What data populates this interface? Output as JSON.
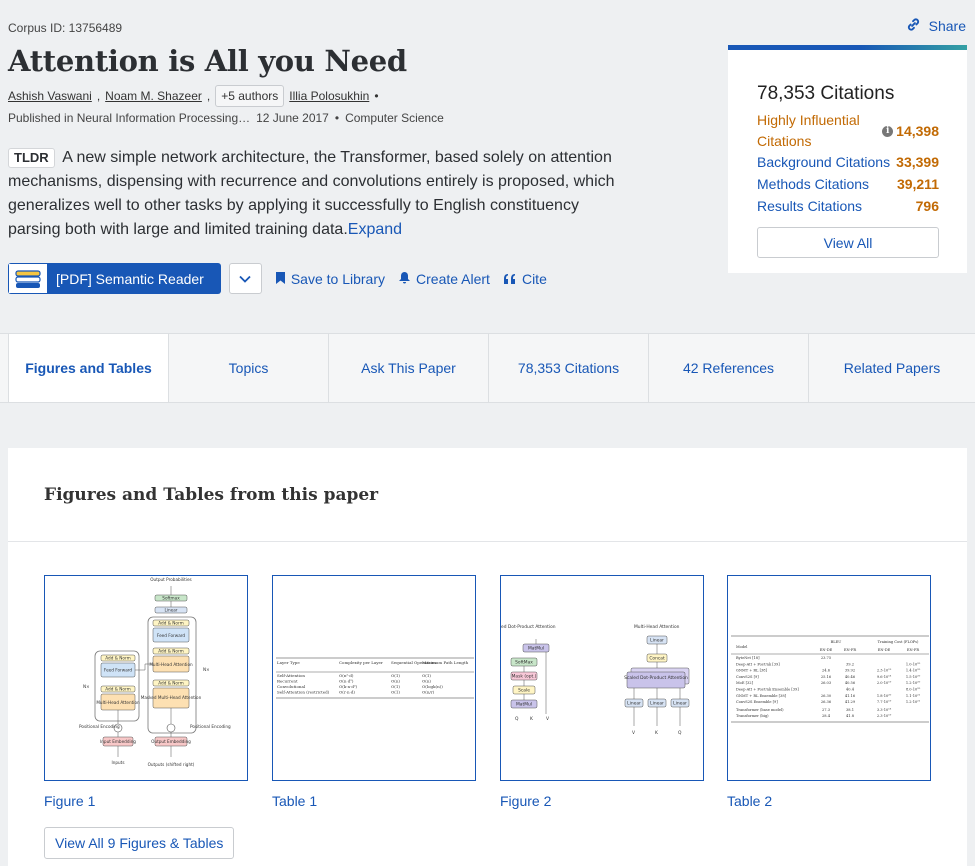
{
  "header": {
    "corpus_id": "Corpus ID: 13756489",
    "share": "Share",
    "title": "Attention is All you Need",
    "authors": [
      "Ashish Vaswani",
      "Noam M. Shazeer"
    ],
    "more_authors": "+5 authors",
    "last_author": "Illia Polosukhin",
    "venue": "Published in Neural Information Processing…",
    "date": "12 June 2017",
    "field": "Computer Science"
  },
  "tldr": {
    "tag": "TLDR",
    "text": "A new simple network architecture, the Transformer, based solely on attention mechanisms, dispensing with recurrence and convolutions entirely is proposed, which generalizes well to other tasks by applying it successfully to English constituency parsing both with large and limited training data.",
    "expand": "Expand"
  },
  "actions": {
    "reader": "[PDF] Semantic Reader",
    "save": "Save to Library",
    "alert": "Create Alert",
    "cite": "Cite"
  },
  "citations": {
    "total": "78,353 Citations",
    "highly_label_1": "Highly Influential",
    "highly_label_2": "Citations",
    "highly_value": "14,398",
    "background_label": "Background Citations",
    "background_value": "33,399",
    "methods_label": "Methods Citations",
    "methods_value": "39,211",
    "results_label": "Results Citations",
    "results_value": "796",
    "view_all": "View All"
  },
  "tabs": [
    {
      "label": "Figures and Tables"
    },
    {
      "label": "Topics"
    },
    {
      "label": "Ask This Paper"
    },
    {
      "label": "78,353 Citations"
    },
    {
      "label": "42 References"
    },
    {
      "label": "Related Papers"
    }
  ],
  "figures": {
    "title": "Figures and Tables from this paper",
    "items": [
      {
        "caption": "Figure 1"
      },
      {
        "caption": "Table 1"
      },
      {
        "caption": "Figure 2"
      },
      {
        "caption": "Table 2"
      }
    ],
    "view_all": "View All 9 Figures & Tables"
  },
  "fig1_labels": {
    "output_probs": "Output Probabilities",
    "softmax": "Softmax",
    "linear": "Linear",
    "add_norm": "Add & Norm",
    "ffn": "Feed Forward",
    "mha": "Multi-Head Attention",
    "masked": "Masked Multi-Head Attention",
    "nx": "N×",
    "pos_enc": "Positional Encoding",
    "in_emb": "Input Embedding",
    "out_emb": "Output Embedding",
    "inputs": "Inputs",
    "outputs": "Outputs (shifted right)"
  },
  "fig2_labels": {
    "sdpa": "ed Dot-Product Attention",
    "mha": "Multi-Head Attention",
    "matmul": "MatMul",
    "softmax": "SoftMax",
    "mask": "Mask (opt.)",
    "scale": "Scale",
    "linear": "Linear",
    "concat": "Concat",
    "sdpa_box": "Scaled Dot-Product Attention",
    "q": "Q",
    "k": "K",
    "v": "V"
  },
  "table1": {
    "headers": [
      "Layer Type",
      "Complexity per Layer",
      "Sequential Operations",
      "Maximum Path Length"
    ],
    "rows": [
      [
        "Self-Attention",
        "O(n²·d)",
        "O(1)",
        "O(1)"
      ],
      [
        "Recurrent",
        "O(n·d²)",
        "O(n)",
        "O(n)"
      ],
      [
        "Convolutional",
        "O(k·n·d²)",
        "O(1)",
        "O(logk(n))"
      ],
      [
        "Self-Attention (restricted)",
        "O(r·n·d)",
        "O(1)",
        "O(n/r)"
      ]
    ]
  },
  "table2": {
    "headers": [
      "Model",
      "BLEU",
      "",
      "Training Cost (FLOPs)",
      ""
    ],
    "subheaders": [
      "",
      "EN-DE",
      "EN-FR",
      "EN-DE",
      "EN-FR"
    ],
    "rows": [
      [
        "ByteNet [18]",
        "23.75",
        "",
        "",
        ""
      ],
      [
        "Deep-Att + PosUnk [39]",
        "",
        "39.2",
        "",
        "1.0·10²⁰"
      ],
      [
        "GNMT + RL [38]",
        "24.6",
        "39.92",
        "2.3·10¹⁹",
        "1.4·10²⁰"
      ],
      [
        "ConvS2S [9]",
        "25.16",
        "40.46",
        "9.6·10¹⁸",
        "1.5·10²⁰"
      ],
      [
        "MoE [32]",
        "26.03",
        "40.56",
        "2.0·10¹⁹",
        "1.2·10²⁰"
      ],
      [
        "Deep-Att + PosUnk Ensemble [39]",
        "",
        "40.4",
        "",
        "8.0·10²⁰"
      ],
      [
        "GNMT + RL Ensemble [38]",
        "26.30",
        "41.16",
        "1.8·10²⁰",
        "1.1·10²¹"
      ],
      [
        "ConvS2S Ensemble [9]",
        "26.36",
        "41.29",
        "7.7·10¹⁹",
        "1.2·10²¹"
      ],
      [
        "Transformer (base model)",
        "27.3",
        "38.1",
        "3.3·10¹⁸",
        ""
      ],
      [
        "Transformer (big)",
        "28.4",
        "41.8",
        "2.3·10¹⁹",
        ""
      ]
    ]
  },
  "colors": {
    "primary": "#1857b6",
    "influential": "#c26a04",
    "background": "#eef0f2"
  }
}
